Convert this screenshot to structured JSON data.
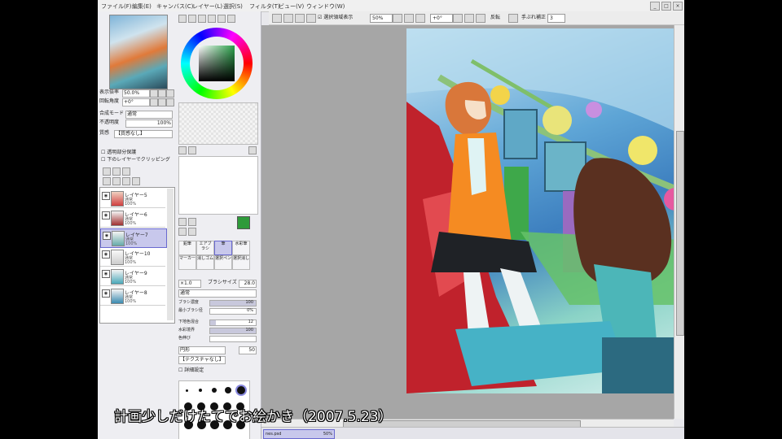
{
  "menu": [
    "ファイル(F)",
    "編集(E)",
    "キャンバス(C)",
    "レイヤー(L)",
    "選択(S)",
    "フィルタ(T)",
    "ビュー(V)",
    "ウィンドウ(W)"
  ],
  "window_controls": [
    "_",
    "□",
    "×"
  ],
  "toolbar": {
    "selection_display": "選択領域表示",
    "zoom": "50%",
    "rotation": "+0°",
    "flip_label": "反転",
    "stabilizer_label": "手ぶれ補正",
    "stabilizer_value": "3"
  },
  "navigator": {
    "zoom_label": "表示倍率",
    "zoom_value": "50.0%",
    "angle_label": "回転角度",
    "angle_value": "+0°"
  },
  "layer_props": {
    "blend_label": "合成モード",
    "blend_value": "通常",
    "opacity_label": "不透明度",
    "opacity_value": "100%",
    "texture_label": "質感",
    "texture_value": "【質感なし】",
    "preserve_opacity": "透明部分保護",
    "clip_lower": "下のレイヤーでクリッピング"
  },
  "layers": [
    {
      "name": "レイヤー5",
      "mode": "通常",
      "opacity": "100%",
      "selected": false
    },
    {
      "name": "レイヤー6",
      "mode": "通常",
      "opacity": "100%",
      "selected": false
    },
    {
      "name": "レイヤー7",
      "mode": "通常",
      "opacity": "100%",
      "selected": true
    },
    {
      "name": "レイヤー10",
      "mode": "通常",
      "opacity": "100%",
      "selected": false
    },
    {
      "name": "レイヤー9",
      "mode": "通常",
      "opacity": "100%",
      "selected": false
    },
    {
      "name": "レイヤー8",
      "mode": "通常",
      "opacity": "100%",
      "selected": false
    }
  ],
  "tools": [
    {
      "label": "鉛筆",
      "selected": false
    },
    {
      "label": "エアブラシ",
      "selected": false
    },
    {
      "label": "筆",
      "selected": true
    },
    {
      "label": "水彩筆",
      "selected": false
    },
    {
      "label": "マーカー",
      "selected": false
    },
    {
      "label": "消しゴム",
      "selected": false
    },
    {
      "label": "選択ペン",
      "selected": false
    },
    {
      "label": "選択消し",
      "selected": false
    }
  ],
  "brush": {
    "size_mult": "×1.0",
    "size_label": "ブラシサイズ",
    "size_value": "28.0",
    "mode_value": "通常",
    "density_label": "ブラシ濃度",
    "density_value": "100",
    "min_size_label": "最小ブラシ径",
    "min_size_value": "0%",
    "mix_label": "下地色混合",
    "mix_value": "12",
    "water_label": "水彩境界",
    "water_value": "100",
    "blur_label": "色伸び",
    "blur_value": "",
    "shape_value": "円形",
    "shape_strength": "50",
    "texture_value": "【テクスチャなし】",
    "detail_settings": "詳細設定"
  },
  "document": {
    "tab_name": "nes.psd",
    "zoom": "50%"
  },
  "caption": "計画少しだけたてでお絵かき（2007.5.23）"
}
